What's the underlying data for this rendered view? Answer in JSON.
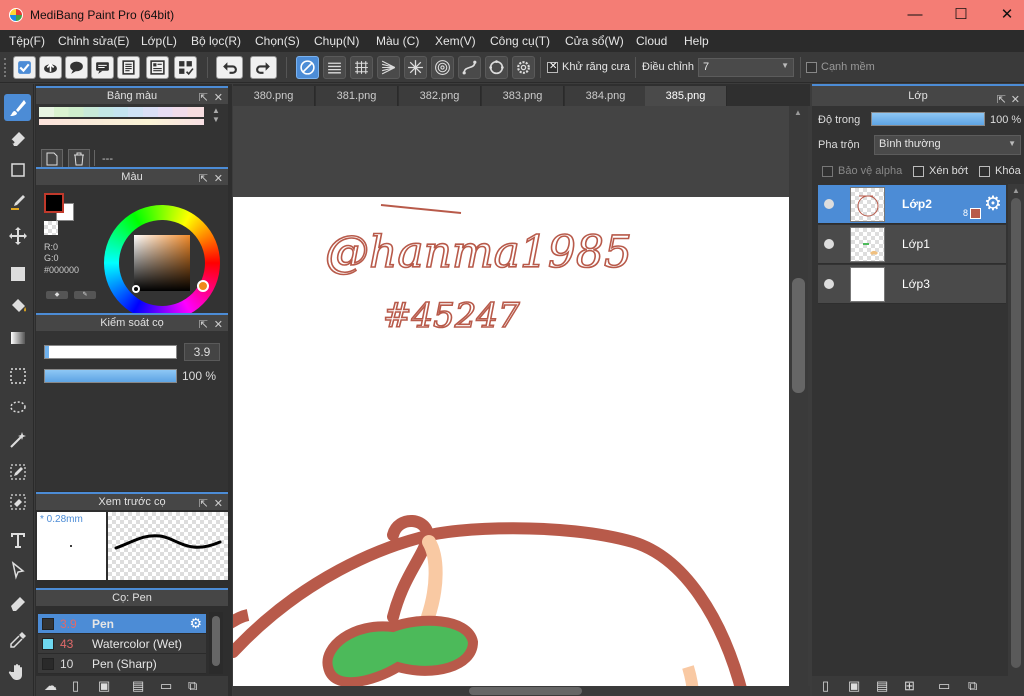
{
  "window": {
    "title": "MediBang Paint Pro (64bit)",
    "controls": [
      "minimize-icon",
      "maximize-icon",
      "close-icon"
    ]
  },
  "menu": [
    "Tệp(F)",
    "Chỉnh sửa(E)",
    "Lớp(L)",
    "Bộ lọc(R)",
    "Chọn(S)",
    "Chụp(N)",
    "Màu (C)",
    "Xem(V)",
    "Công cụ(T)",
    "Cửa sổ(W)",
    "Cloud",
    "Help"
  ],
  "toolbar": {
    "antialias_label": "Khử răng cưa",
    "adjust_label": "Điều chỉnh",
    "adjust_value": "7",
    "soft_edge_label": "Cạnh mềm"
  },
  "palette_panel": {
    "title": "Bảng màu",
    "placeholder": "---"
  },
  "color_panel": {
    "title": "Màu",
    "r": "R:0",
    "g": "G:0",
    "hex": "#000000",
    "foreground": "#000000",
    "background": "#ffffff"
  },
  "brush_control": {
    "title": "Kiểm soát cọ",
    "size_value": "3.9",
    "opacity_value": "100 %",
    "size_fraction": 0.03,
    "opacity_fraction": 1.0
  },
  "brush_preview": {
    "title": "Xem trước cọ",
    "size_label": "* 0.28mm"
  },
  "brush_panel": {
    "title": "Cọ: Pen",
    "items": [
      {
        "size": "3.9",
        "name": "Pen",
        "color": "#333333",
        "active": true
      },
      {
        "size": "43",
        "name": "Watercolor (Wet)",
        "color": "#6ed8f0",
        "active": false
      },
      {
        "size": "10",
        "name": "Pen (Sharp)",
        "color": "#2a2a2a",
        "active": false
      }
    ]
  },
  "tabs": [
    "380.png",
    "381.png",
    "382.png",
    "383.png",
    "384.png",
    "385.png"
  ],
  "active_tab": "385.png",
  "canvas": {
    "handwriting_line1": "@hanma1985",
    "handwriting_line2": "#45247",
    "ink_color": "#b85a4a"
  },
  "layer_panel": {
    "title": "Lớp",
    "opacity_label": "Độ trong",
    "opacity_value": "100 %",
    "blend_label": "Pha trộn",
    "blend_value": "Bình thường",
    "protect_alpha": "Bảo vệ alpha",
    "clipping": "Xén bớt",
    "lock": "Khóa",
    "layers": [
      {
        "name": "Lớp2",
        "badge": "8",
        "active": true
      },
      {
        "name": "Lớp1",
        "active": false
      },
      {
        "name": "Lớp3",
        "active": false
      }
    ]
  },
  "accent_color": "#4c8cd6"
}
